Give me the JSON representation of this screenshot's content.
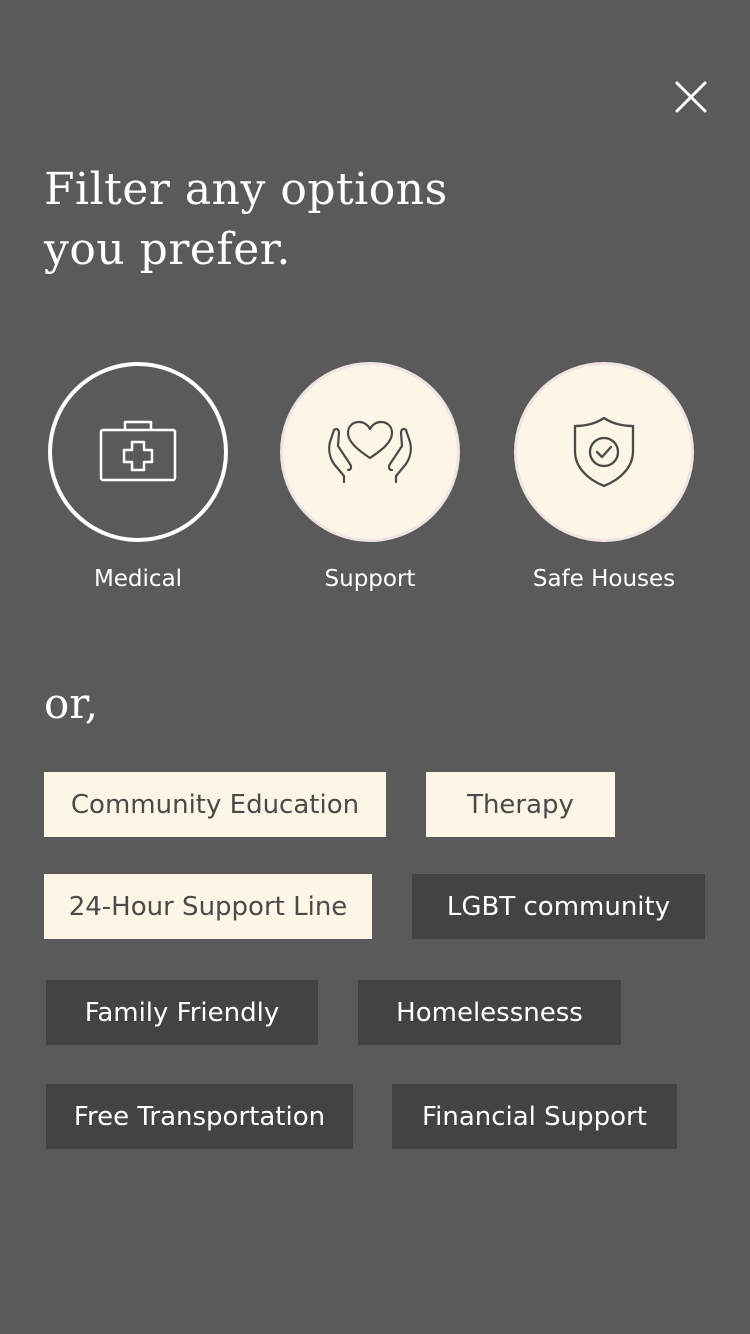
{
  "header": {
    "title_line1": "Filter any options",
    "title_line2": "you prefer.",
    "close_icon": "close-icon"
  },
  "categories": [
    {
      "label": "Medical",
      "icon": "medical-kit-icon",
      "selected": false
    },
    {
      "label": "Support",
      "icon": "heart-hands-icon",
      "selected": true
    },
    {
      "label": "Safe Houses",
      "icon": "shield-check-icon",
      "selected": true
    }
  ],
  "or_label": "or,",
  "tags": [
    {
      "label": "Community Education",
      "selected": true
    },
    {
      "label": "Therapy",
      "selected": true
    },
    {
      "label": "24-Hour Support Line",
      "selected": true
    },
    {
      "label": "LGBT community",
      "selected": false
    },
    {
      "label": "Family Friendly",
      "selected": false
    },
    {
      "label": "Homelessness",
      "selected": false
    },
    {
      "label": "Free Transportation",
      "selected": false
    },
    {
      "label": "Financial Support",
      "selected": false
    }
  ],
  "colors": {
    "background": "#5a5a5a",
    "selected_fill": "#fdf6e6",
    "unselected_fill": "#434343",
    "icon_stroke": "#4a4a4a"
  }
}
